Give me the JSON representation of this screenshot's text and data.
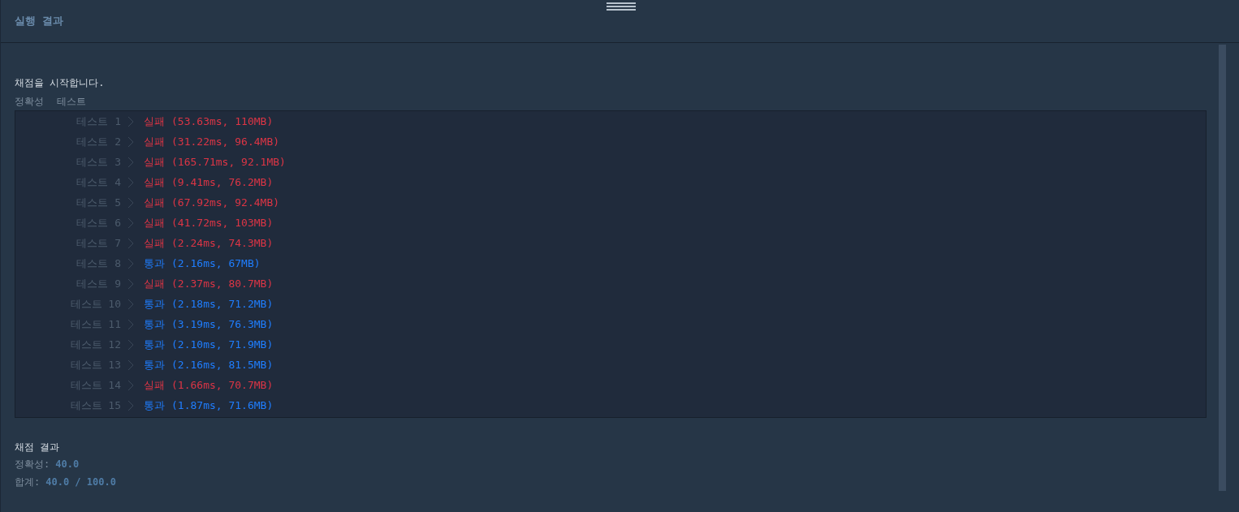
{
  "panel": {
    "title": "실행 결과"
  },
  "intro": "채점을 시작합니다.",
  "section_labels": [
    "정확성",
    "테스트"
  ],
  "tests": [
    {
      "label": "테스트 1",
      "kind": "fail",
      "verdict": "실패",
      "detail": "(53.63ms, 110MB)"
    },
    {
      "label": "테스트 2",
      "kind": "fail",
      "verdict": "실패",
      "detail": "(31.22ms, 96.4MB)"
    },
    {
      "label": "테스트 3",
      "kind": "fail",
      "verdict": "실패",
      "detail": "(165.71ms, 92.1MB)"
    },
    {
      "label": "테스트 4",
      "kind": "fail",
      "verdict": "실패",
      "detail": "(9.41ms, 76.2MB)"
    },
    {
      "label": "테스트 5",
      "kind": "fail",
      "verdict": "실패",
      "detail": "(67.92ms, 92.4MB)"
    },
    {
      "label": "테스트 6",
      "kind": "fail",
      "verdict": "실패",
      "detail": "(41.72ms, 103MB)"
    },
    {
      "label": "테스트 7",
      "kind": "fail",
      "verdict": "실패",
      "detail": "(2.24ms, 74.3MB)"
    },
    {
      "label": "테스트 8",
      "kind": "pass",
      "verdict": "통과",
      "detail": "(2.16ms, 67MB)"
    },
    {
      "label": "테스트 9",
      "kind": "fail",
      "verdict": "실패",
      "detail": "(2.37ms, 80.7MB)"
    },
    {
      "label": "테스트 10",
      "kind": "pass",
      "verdict": "통과",
      "detail": "(2.18ms, 71.2MB)"
    },
    {
      "label": "테스트 11",
      "kind": "pass",
      "verdict": "통과",
      "detail": "(3.19ms, 76.3MB)"
    },
    {
      "label": "테스트 12",
      "kind": "pass",
      "verdict": "통과",
      "detail": "(2.10ms, 71.9MB)"
    },
    {
      "label": "테스트 13",
      "kind": "pass",
      "verdict": "통과",
      "detail": "(2.16ms, 81.5MB)"
    },
    {
      "label": "테스트 14",
      "kind": "fail",
      "verdict": "실패",
      "detail": "(1.66ms, 70.7MB)"
    },
    {
      "label": "테스트 15",
      "kind": "pass",
      "verdict": "통과",
      "detail": "(1.87ms, 71.6MB)"
    }
  ],
  "result": {
    "title": "채점 결과",
    "lines": [
      {
        "label": "정확성:",
        "value": "40.0"
      },
      {
        "label": "합계:",
        "value": "40.0 / 100.0"
      }
    ]
  }
}
